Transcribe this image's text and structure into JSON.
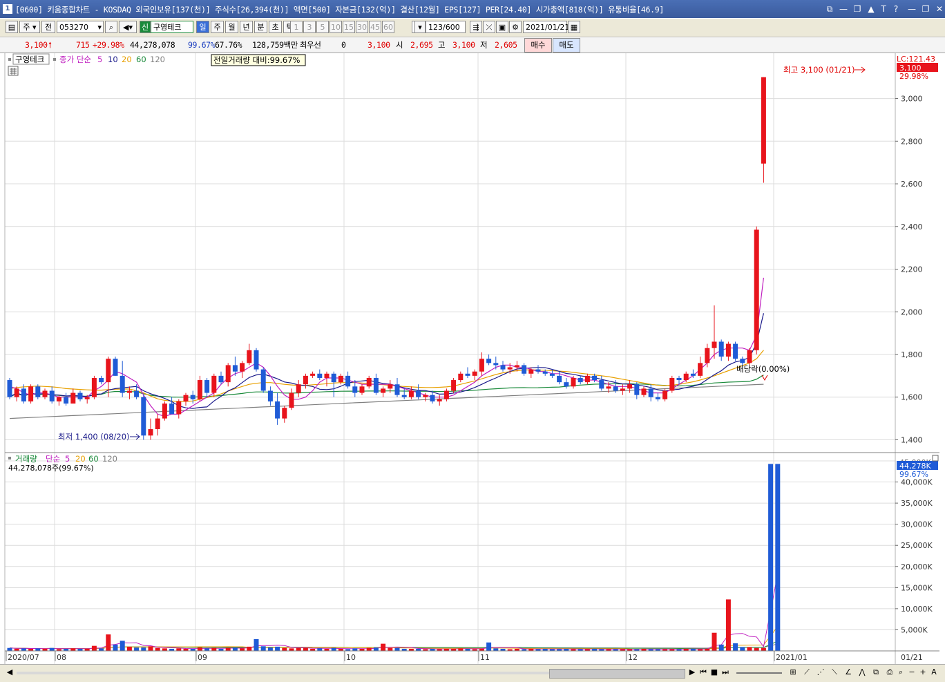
{
  "window": {
    "icon_label": "1",
    "title": "[0600] 키움종합차트 - KOSDAQ 외국인보유[137(천)] 주식수[26,394(천)] 액면[500] 자본금[132(억)] 결산[12월] EPS[127] PER[24.40] 시가총액[818(억)] 유통비율[46.9]",
    "controls": [
      "⧉",
      "—",
      "❐",
      "▲",
      "T",
      "?",
      "—",
      "❐",
      "✕"
    ]
  },
  "toolbar": {
    "period_select": "주",
    "all_label": "전",
    "stock_code": "053270",
    "new_badge": "신",
    "stock_name": "구영테크",
    "periods": [
      "일",
      "주",
      "월",
      "년",
      "분",
      "초",
      "틱"
    ],
    "active_period": "일",
    "intervals": [
      "1",
      "3",
      "5",
      "10",
      "15",
      "30",
      "45",
      "60"
    ],
    "custom_interval": "3",
    "count_value": "123",
    "count_total": "/600",
    "date": "2021/01/21"
  },
  "quote": {
    "price": "3,100",
    "change": "715",
    "change_pct": "+29.98%",
    "volume": "44,278,078",
    "vol_ratio": "99.67%",
    "turnover": "67.76%",
    "amount": "128,759백만",
    "bid_label": "최우선",
    "bid_qty": "0",
    "bid_price": "3,100",
    "open_label": "시",
    "open": "2,695",
    "high_label": "고",
    "high": "3,100",
    "low_label": "저",
    "low": "2,605",
    "buy_label": "매수",
    "sell_label": "매도"
  },
  "price_panel": {
    "stock_tag": "구영테크",
    "ma_label": "종가 단순",
    "ma_periods": [
      "5",
      "10",
      "20",
      "60",
      "120"
    ],
    "tooltip": "전일거래량 대비:99.67%",
    "lc_label": "LC:121.43",
    "last_price_badge": "3,100",
    "last_pct_badge": "29.98%",
    "high_annotation": "최고 3,100 (01/21)",
    "low_annotation": "최저 1,400 (08/20)",
    "dividend_annotation": "배당락(0.00%)"
  },
  "volume_panel": {
    "label": "거래량",
    "ma_label": "단순",
    "ma_periods": [
      "5",
      "20",
      "60",
      "120"
    ],
    "info": "44,278,078주(99.67%)",
    "top_tick": "45,000K",
    "last_vol_badge": "44,278K",
    "last_pct_badge": "99.67%"
  },
  "x_axis_labels": [
    "2020/07",
    "08",
    "09",
    "10",
    "11",
    "12",
    "2021/01"
  ],
  "x_axis_last": "01/21",
  "colors": {
    "up": "#e8141c",
    "down": "#1f5bd6",
    "ma5": "#c020c0",
    "ma10": "#1a1a8a",
    "ma20": "#e8a000",
    "ma60": "#1a8a3a",
    "ma120": "#808080"
  },
  "chart_data": [
    {
      "type": "candlestick",
      "title": "",
      "y_ticks": [
        1400,
        1600,
        1800,
        2000,
        2200,
        2400,
        2600,
        2800,
        3000
      ],
      "ylim": [
        1340,
        3180
      ],
      "x_ticks": [
        "2020/07",
        "08",
        "09",
        "10",
        "11",
        "12",
        "2021/01"
      ],
      "ohlc": [
        [
          1680,
          1690,
          1590,
          1600
        ],
        [
          1600,
          1650,
          1580,
          1640
        ],
        [
          1640,
          1660,
          1570,
          1580
        ],
        [
          1580,
          1660,
          1570,
          1650
        ],
        [
          1650,
          1660,
          1590,
          1600
        ],
        [
          1600,
          1640,
          1590,
          1630
        ],
        [
          1630,
          1650,
          1570,
          1580
        ],
        [
          1580,
          1610,
          1560,
          1600
        ],
        [
          1600,
          1620,
          1560,
          1570
        ],
        [
          1570,
          1640,
          1570,
          1620
        ],
        [
          1620,
          1630,
          1580,
          1590
        ],
        [
          1590,
          1610,
          1570,
          1600
        ],
        [
          1600,
          1700,
          1590,
          1690
        ],
        [
          1690,
          1700,
          1660,
          1670
        ],
        [
          1670,
          1790,
          1600,
          1780
        ],
        [
          1780,
          1790,
          1700,
          1700
        ],
        [
          1700,
          1770,
          1600,
          1620
        ],
        [
          1620,
          1650,
          1590,
          1630
        ],
        [
          1630,
          1660,
          1590,
          1600
        ],
        [
          1600,
          1610,
          1400,
          1420
        ],
        [
          1420,
          1500,
          1400,
          1450
        ],
        [
          1450,
          1520,
          1420,
          1500
        ],
        [
          1500,
          1580,
          1490,
          1570
        ],
        [
          1570,
          1600,
          1520,
          1520
        ],
        [
          1520,
          1590,
          1500,
          1580
        ],
        [
          1580,
          1620,
          1560,
          1610
        ],
        [
          1610,
          1630,
          1570,
          1590
        ],
        [
          1590,
          1700,
          1580,
          1680
        ],
        [
          1680,
          1690,
          1600,
          1620
        ],
        [
          1620,
          1710,
          1600,
          1700
        ],
        [
          1700,
          1720,
          1660,
          1670
        ],
        [
          1670,
          1760,
          1650,
          1750
        ],
        [
          1750,
          1790,
          1700,
          1720
        ],
        [
          1720,
          1770,
          1690,
          1760
        ],
        [
          1760,
          1850,
          1750,
          1820
        ],
        [
          1820,
          1830,
          1720,
          1730
        ],
        [
          1730,
          1740,
          1620,
          1630
        ],
        [
          1630,
          1650,
          1560,
          1580
        ],
        [
          1580,
          1620,
          1470,
          1500
        ],
        [
          1500,
          1560,
          1480,
          1550
        ],
        [
          1550,
          1640,
          1540,
          1620
        ],
        [
          1620,
          1680,
          1600,
          1660
        ],
        [
          1660,
          1710,
          1640,
          1700
        ],
        [
          1700,
          1720,
          1690,
          1710
        ],
        [
          1710,
          1730,
          1680,
          1690
        ],
        [
          1690,
          1720,
          1650,
          1710
        ],
        [
          1710,
          1720,
          1600,
          1670
        ],
        [
          1670,
          1710,
          1660,
          1700
        ],
        [
          1700,
          1720,
          1640,
          1650
        ],
        [
          1650,
          1680,
          1600,
          1620
        ],
        [
          1620,
          1660,
          1610,
          1650
        ],
        [
          1650,
          1700,
          1640,
          1690
        ],
        [
          1690,
          1710,
          1610,
          1620
        ],
        [
          1620,
          1650,
          1600,
          1640
        ],
        [
          1640,
          1680,
          1620,
          1660
        ],
        [
          1660,
          1690,
          1600,
          1610
        ],
        [
          1610,
          1640,
          1590,
          1600
        ],
        [
          1600,
          1650,
          1590,
          1630
        ],
        [
          1630,
          1660,
          1590,
          1600
        ],
        [
          1600,
          1620,
          1580,
          1610
        ],
        [
          1610,
          1630,
          1570,
          1580
        ],
        [
          1580,
          1610,
          1560,
          1590
        ],
        [
          1590,
          1640,
          1580,
          1630
        ],
        [
          1630,
          1690,
          1620,
          1680
        ],
        [
          1680,
          1720,
          1670,
          1710
        ],
        [
          1710,
          1740,
          1690,
          1700
        ],
        [
          1700,
          1730,
          1680,
          1720
        ],
        [
          1720,
          1810,
          1700,
          1780
        ],
        [
          1780,
          1800,
          1750,
          1760
        ],
        [
          1760,
          1790,
          1730,
          1750
        ],
        [
          1750,
          1770,
          1720,
          1730
        ],
        [
          1730,
          1760,
          1710,
          1740
        ],
        [
          1740,
          1770,
          1720,
          1750
        ],
        [
          1750,
          1760,
          1700,
          1710
        ],
        [
          1710,
          1740,
          1690,
          1730
        ],
        [
          1730,
          1750,
          1710,
          1720
        ],
        [
          1720,
          1730,
          1700,
          1710
        ],
        [
          1710,
          1730,
          1690,
          1700
        ],
        [
          1700,
          1720,
          1660,
          1670
        ],
        [
          1670,
          1690,
          1640,
          1650
        ],
        [
          1650,
          1700,
          1640,
          1690
        ],
        [
          1690,
          1700,
          1660,
          1670
        ],
        [
          1670,
          1710,
          1660,
          1700
        ],
        [
          1700,
          1710,
          1670,
          1680
        ],
        [
          1680,
          1700,
          1630,
          1640
        ],
        [
          1640,
          1670,
          1620,
          1650
        ],
        [
          1650,
          1680,
          1620,
          1630
        ],
        [
          1630,
          1660,
          1610,
          1640
        ],
        [
          1640,
          1680,
          1620,
          1660
        ],
        [
          1660,
          1670,
          1590,
          1610
        ],
        [
          1610,
          1650,
          1600,
          1640
        ],
        [
          1640,
          1660,
          1580,
          1600
        ],
        [
          1600,
          1620,
          1580,
          1590
        ],
        [
          1590,
          1640,
          1580,
          1630
        ],
        [
          1630,
          1700,
          1620,
          1690
        ],
        [
          1690,
          1700,
          1660,
          1680
        ],
        [
          1680,
          1720,
          1670,
          1710
        ],
        [
          1710,
          1730,
          1690,
          1700
        ],
        [
          1700,
          1790,
          1690,
          1760
        ],
        [
          1760,
          1850,
          1740,
          1830
        ],
        [
          1830,
          2030,
          1780,
          1860
        ],
        [
          1860,
          1870,
          1770,
          1790
        ],
        [
          1790,
          1860,
          1770,
          1850
        ],
        [
          1850,
          1860,
          1770,
          1780
        ],
        [
          1780,
          1790,
          1740,
          1760
        ],
        [
          1760,
          1830,
          1750,
          1820
        ],
        [
          1820,
          2400,
          1800,
          2385
        ],
        [
          2695,
          3100,
          2605,
          3100
        ]
      ],
      "ma5": [
        1650,
        1640,
        1620,
        1610,
        1620,
        1620,
        1610,
        1600,
        1600,
        1600,
        1600,
        1600,
        1630,
        1650,
        1680,
        1720,
        1710,
        1690,
        1670,
        1610,
        1560,
        1520,
        1510,
        1520,
        1520,
        1540,
        1560,
        1580,
        1600,
        1620,
        1660,
        1690,
        1710,
        1720,
        1740,
        1760,
        1740,
        1700,
        1650,
        1610,
        1590,
        1590,
        1600,
        1630,
        1670,
        1690,
        1690,
        1690,
        1680,
        1670,
        1660,
        1660,
        1660,
        1660,
        1660,
        1650,
        1640,
        1630,
        1620,
        1610,
        1600,
        1600,
        1600,
        1610,
        1630,
        1650,
        1670,
        1700,
        1720,
        1740,
        1750,
        1750,
        1740,
        1740,
        1730,
        1720,
        1720,
        1710,
        1710,
        1700,
        1690,
        1680,
        1680,
        1680,
        1670,
        1660,
        1650,
        1650,
        1650,
        1640,
        1630,
        1620,
        1620,
        1620,
        1640,
        1660,
        1680,
        1700,
        1730,
        1760,
        1800,
        1820,
        1830,
        1830,
        1830,
        1820,
        1890,
        2160
      ],
      "ma20": [
        1640,
        1645,
        1648,
        1650,
        1652,
        1650,
        1648,
        1645,
        1640,
        1638,
        1636,
        1634,
        1633,
        1633,
        1635,
        1637,
        1638,
        1638,
        1630,
        1620,
        1605,
        1592,
        1585,
        1582,
        1580,
        1580,
        1582,
        1590,
        1598,
        1605,
        1615,
        1628,
        1640,
        1650,
        1660,
        1665,
        1668,
        1668,
        1664,
        1660,
        1657,
        1655,
        1655,
        1658,
        1660,
        1663,
        1666,
        1668,
        1668,
        1668,
        1666,
        1663,
        1660,
        1658,
        1655,
        1652,
        1650,
        1648,
        1646,
        1645,
        1645,
        1646,
        1648,
        1652,
        1660,
        1668,
        1676,
        1686,
        1696,
        1706,
        1714,
        1720,
        1724,
        1727,
        1728,
        1727,
        1726,
        1724,
        1722,
        1720,
        1716,
        1712,
        1708,
        1704,
        1700,
        1696,
        1690,
        1684,
        1678,
        1672,
        1666,
        1660,
        1656,
        1654,
        1656,
        1660,
        1666,
        1672,
        1680,
        1690,
        1700,
        1712,
        1724,
        1736,
        1748,
        1760,
        1780,
        1820
      ]
    },
    {
      "type": "bar",
      "title": "",
      "y_ticks": [
        5000,
        10000,
        15000,
        20000,
        25000,
        30000,
        35000,
        40000,
        45000
      ],
      "y_tick_labels": [
        "5,000K",
        "10,000K",
        "15,000K",
        "20,000K",
        "25,000K",
        "30,000K",
        "35,000K",
        "40,000K",
        "45,000K"
      ],
      "ylim": [
        0,
        45000
      ],
      "unit": "K",
      "values": [
        700,
        500,
        600,
        500,
        600,
        500,
        700,
        400,
        500,
        600,
        500,
        500,
        1200,
        600,
        3900,
        1500,
        2400,
        1000,
        800,
        800,
        1100,
        700,
        600,
        500,
        600,
        500,
        500,
        800,
        600,
        700,
        500,
        700,
        800,
        600,
        1000,
        2800,
        1100,
        800,
        1000,
        700,
        600,
        700,
        700,
        500,
        600,
        500,
        700,
        500,
        400,
        600,
        500,
        700,
        800,
        1700,
        700,
        700,
        500,
        500,
        500,
        400,
        500,
        400,
        500,
        500,
        600,
        500,
        400,
        500,
        2000,
        600,
        500,
        400,
        500,
        400,
        500,
        400,
        500,
        400,
        400,
        500,
        400,
        400,
        400,
        500,
        400,
        400,
        400,
        400,
        400,
        400,
        500,
        400,
        400,
        400,
        400,
        400,
        500,
        500,
        400,
        500,
        4300,
        1500,
        12200,
        1800,
        900,
        900,
        700,
        700,
        44278,
        44278
      ]
    }
  ]
}
